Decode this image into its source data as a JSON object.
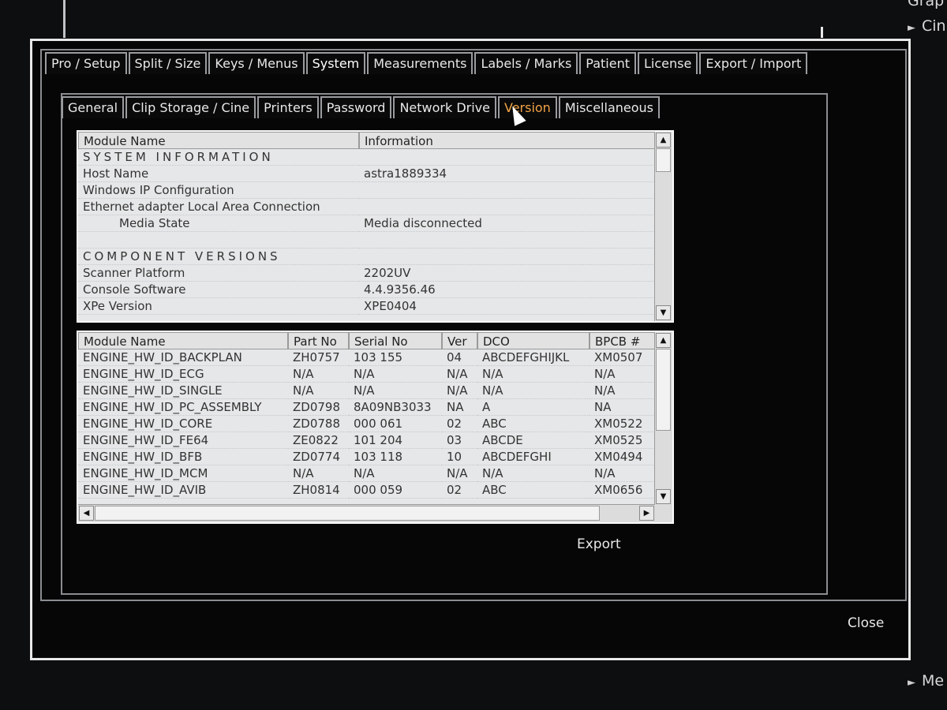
{
  "background": {
    "side_labels": [
      "Grap",
      "Cin",
      "Me"
    ]
  },
  "tabs": [
    {
      "label": "Pro / Setup",
      "active": false
    },
    {
      "label": "Split / Size",
      "active": false
    },
    {
      "label": "Keys / Menus",
      "active": false
    },
    {
      "label": "System",
      "active": true
    },
    {
      "label": "Measurements",
      "active": false
    },
    {
      "label": "Labels / Marks",
      "active": false
    },
    {
      "label": "Patient",
      "active": false
    },
    {
      "label": "License",
      "active": false
    },
    {
      "label": "Export / Import",
      "active": false
    }
  ],
  "subtabs": [
    {
      "label": "General",
      "active": false
    },
    {
      "label": "Clip Storage / Cine",
      "active": false
    },
    {
      "label": "Printers",
      "active": false
    },
    {
      "label": "Password",
      "active": false
    },
    {
      "label": "Network Drive",
      "active": false
    },
    {
      "label": "Version",
      "active": true
    },
    {
      "label": "Miscellaneous",
      "active": false
    }
  ],
  "info_table": {
    "headers": [
      "Module Name",
      "Information"
    ],
    "rows": [
      {
        "name": "SYSTEM INFORMATION",
        "info": "",
        "type": "section"
      },
      {
        "name": "Host Name",
        "info": "astra1889334",
        "type": "row"
      },
      {
        "name": "Windows IP Configuration",
        "info": "",
        "type": "row"
      },
      {
        "name": "Ethernet adapter Local Area Connection",
        "info": "",
        "type": "row"
      },
      {
        "name": "Media State",
        "info": "Media disconnected",
        "type": "indent"
      },
      {
        "name": "",
        "info": "",
        "type": "row"
      },
      {
        "name": "COMPONENT VERSIONS",
        "info": "",
        "type": "section"
      },
      {
        "name": "Scanner Platform",
        "info": "2202UV",
        "type": "row"
      },
      {
        "name": "Console Software",
        "info": "4.4.9356.46",
        "type": "row"
      },
      {
        "name": "XPe Version",
        "info": "XPE0404",
        "type": "row"
      }
    ]
  },
  "hw_table": {
    "headers": [
      "Module Name",
      "Part No",
      "Serial No",
      "Ver",
      "DCO",
      "BPCB #"
    ],
    "rows": [
      [
        "ENGINE_HW_ID_BACKPLAN",
        "ZH0757",
        "103 155",
        "04",
        "ABCDEFGHIJKL",
        "XM0507"
      ],
      [
        "ENGINE_HW_ID_ECG",
        "N/A",
        "N/A",
        "N/A",
        "N/A",
        "N/A"
      ],
      [
        "ENGINE_HW_ID_SINGLE",
        "N/A",
        "N/A",
        "N/A",
        "N/A",
        "N/A"
      ],
      [
        "ENGINE_HW_ID_PC_ASSEMBLY",
        "ZD0798",
        "8A09NB3033",
        "NA",
        "A",
        "NA"
      ],
      [
        "ENGINE_HW_ID_CORE",
        "ZD0788",
        "000 061",
        "02",
        "ABC",
        "XM0522"
      ],
      [
        "ENGINE_HW_ID_FE64",
        "ZE0822",
        "101 204",
        "03",
        "ABCDE",
        "XM0525"
      ],
      [
        "ENGINE_HW_ID_BFB",
        "ZD0774",
        "103 118",
        "10",
        "ABCDEFGHI",
        "XM0494"
      ],
      [
        "ENGINE_HW_ID_MCM",
        "N/A",
        "N/A",
        "N/A",
        "N/A",
        "N/A"
      ],
      [
        "ENGINE_HW_ID_AVIB",
        "ZH0814",
        "000 059",
        "02",
        "ABC",
        "XM0656"
      ]
    ]
  },
  "buttons": {
    "export": "Export",
    "close": "Close"
  },
  "icons": {
    "scroll_up": "▲",
    "scroll_down": "▼",
    "scroll_left": "◀",
    "scroll_right": "▶",
    "arrow": "►"
  }
}
